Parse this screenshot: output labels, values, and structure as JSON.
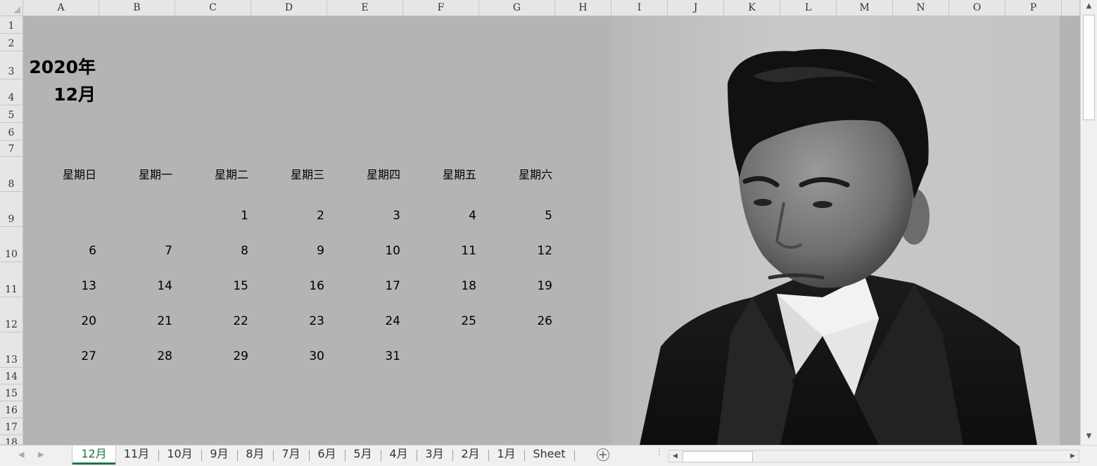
{
  "columns": [
    "A",
    "B",
    "C",
    "D",
    "E",
    "F",
    "G",
    "H",
    "I",
    "J",
    "K",
    "L",
    "M",
    "N",
    "O",
    "P"
  ],
  "rows": [
    "1",
    "2",
    "3",
    "4",
    "5",
    "6",
    "7",
    "8",
    "9",
    "10",
    "11",
    "12",
    "13",
    "14",
    "15",
    "16",
    "17",
    "18"
  ],
  "calendar": {
    "year": "2020年",
    "month": "12月",
    "weekdays": [
      "星期日",
      "星期一",
      "星期二",
      "星期三",
      "星期四",
      "星期五",
      "星期六"
    ],
    "weeks": [
      [
        "",
        "",
        "1",
        "2",
        "3",
        "4",
        "5"
      ],
      [
        "6",
        "7",
        "8",
        "9",
        "10",
        "11",
        "12"
      ],
      [
        "13",
        "14",
        "15",
        "16",
        "17",
        "18",
        "19"
      ],
      [
        "20",
        "21",
        "22",
        "23",
        "24",
        "25",
        "26"
      ],
      [
        "27",
        "28",
        "29",
        "30",
        "31",
        "",
        ""
      ]
    ]
  },
  "photo": {
    "subject": "black-and-white portrait of a man in a dark suit"
  },
  "sheet_tabs": [
    "12月",
    "11月",
    "10月",
    "9月",
    "8月",
    "7月",
    "6月",
    "5月",
    "4月",
    "3月",
    "2月",
    "1月",
    "Sheet"
  ],
  "active_tab": "12月",
  "add_sheet_label": "+"
}
